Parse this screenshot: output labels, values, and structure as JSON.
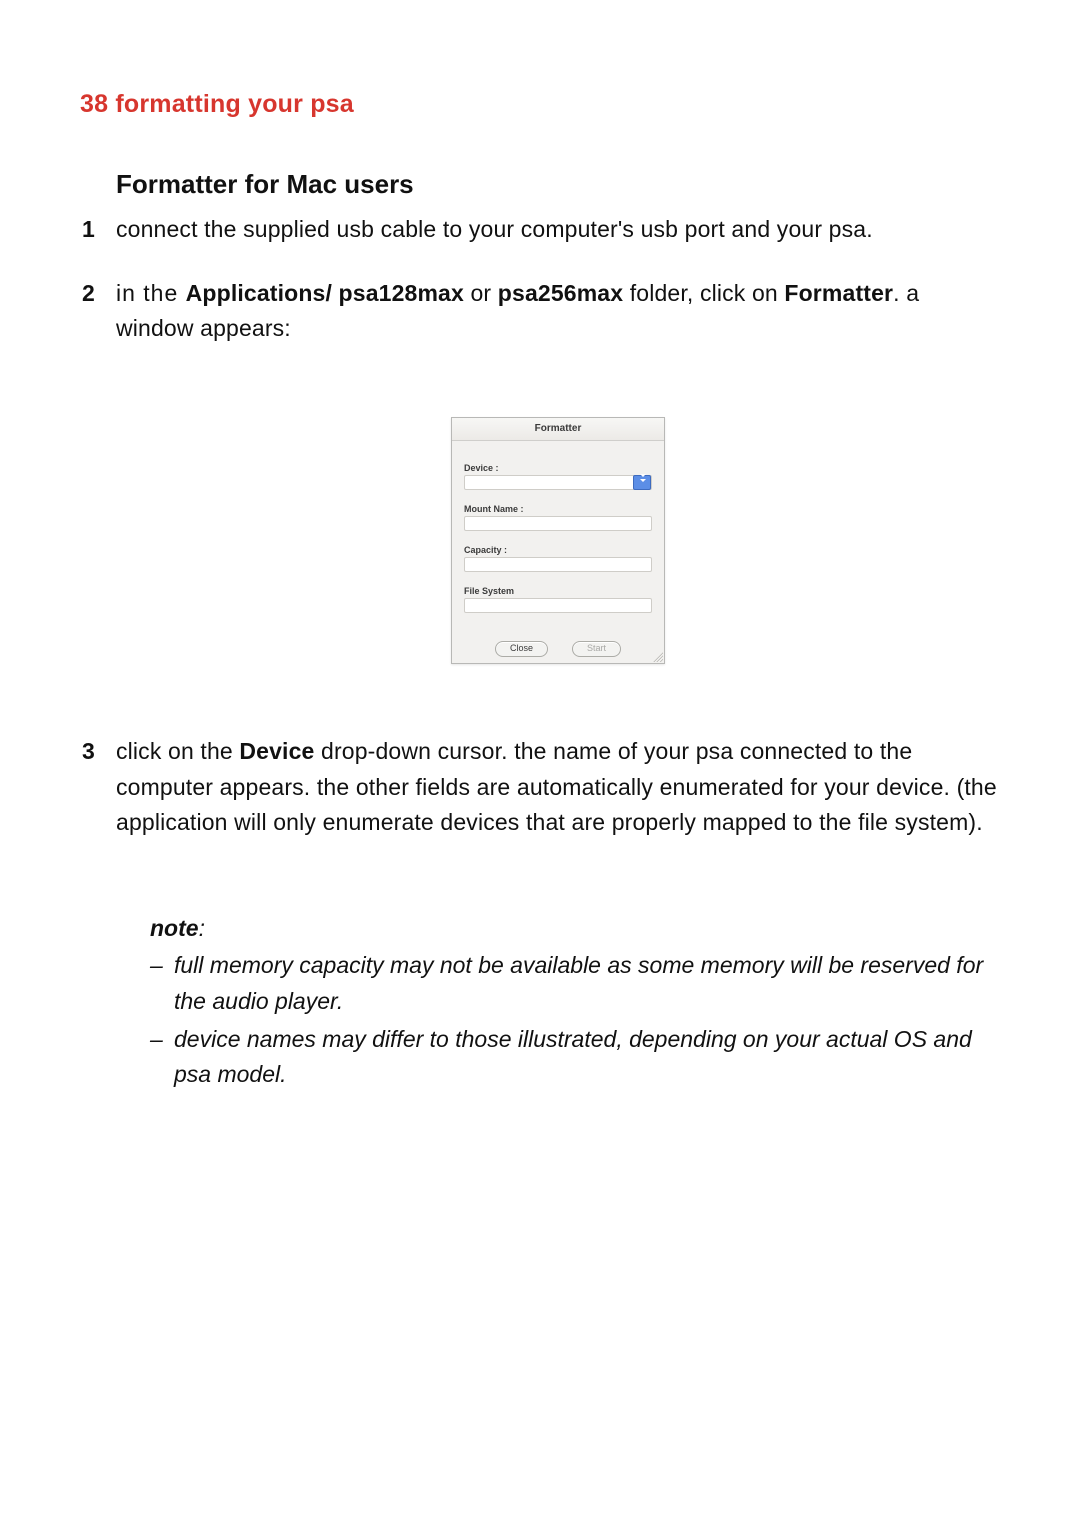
{
  "header": "38 formatting your psa",
  "subhead": "Formatter for Mac users",
  "steps": {
    "s1": {
      "num": "1",
      "text": "connect the supplied usb cable to your computer's usb port and your psa."
    },
    "s2": {
      "num": "2",
      "in_the": "in the ",
      "apps_bold": "Applications/ psa128max",
      "or": " or ",
      "psa256_bold": "psa256max",
      "folder_click": " folder, click on ",
      "formatter_bold": "Formatter",
      "rest": ". a window appears:"
    },
    "s3": {
      "num": "3",
      "pre": "click on the ",
      "device_bold": "Device",
      "post": " drop-down cursor. the name of your psa connected to the computer appears. the other fields are automatically enumerated for your device. (the application will only enumerate devices that are properly mapped to the file system)."
    }
  },
  "window": {
    "title": "Formatter",
    "device_label": "Device :",
    "mount_label": "Mount Name :",
    "capacity_label": "Capacity :",
    "fs_label": "File System",
    "close": "Close",
    "start": "Start"
  },
  "notes": {
    "head": "note",
    "colon": ":",
    "n1": "full memory capacity may not be available as some memory will be reserved for the audio player.",
    "n2": "device names may differ to those illustrated, depending on your actual OS and psa model."
  }
}
